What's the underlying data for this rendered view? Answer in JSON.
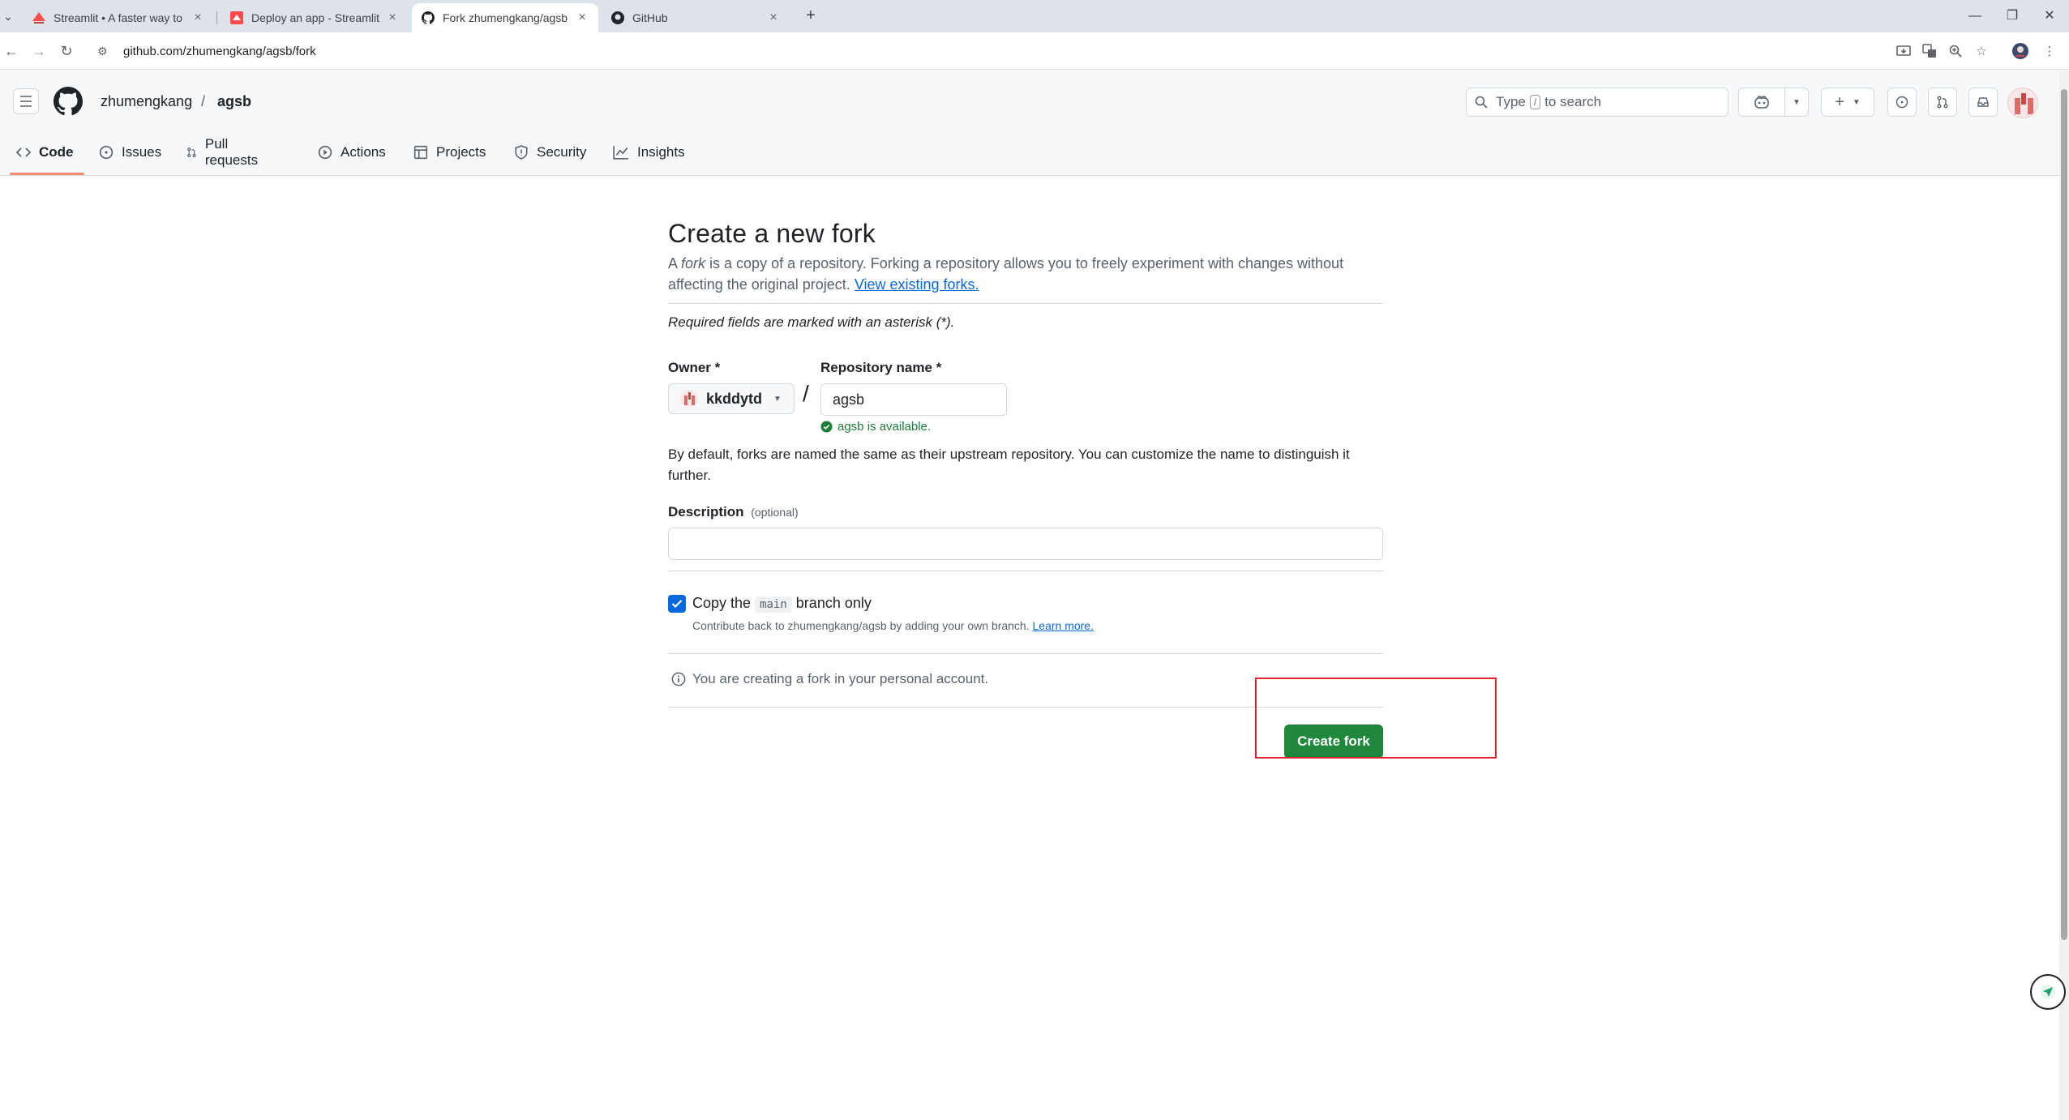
{
  "browser": {
    "tabs": [
      {
        "title": "Streamlit • A faster way to bu",
        "icon": "streamlit-icon"
      },
      {
        "title": "Deploy an app - Streamlit",
        "icon": "streamlit-icon"
      },
      {
        "title": "Fork zhumengkang/agsb",
        "icon": "github-icon",
        "active": true
      },
      {
        "title": "GitHub",
        "icon": "github-icon"
      }
    ],
    "url": "github.com/zhumengkang/agsb/fork"
  },
  "header": {
    "owner": "zhumengkang",
    "separator": "/",
    "repo": "agsb",
    "search": {
      "prefix": "Type",
      "key": "/",
      "suffix": "to search"
    }
  },
  "repo_nav": [
    {
      "label": "Code",
      "icon": "code-icon",
      "active": true
    },
    {
      "label": "Issues",
      "icon": "issue-icon"
    },
    {
      "label": "Pull requests",
      "icon": "pull-request-icon"
    },
    {
      "label": "Actions",
      "icon": "play-icon"
    },
    {
      "label": "Projects",
      "icon": "table-icon"
    },
    {
      "label": "Security",
      "icon": "shield-icon"
    },
    {
      "label": "Insights",
      "icon": "graph-icon"
    }
  ],
  "form": {
    "title": "Create a new fork",
    "lead_a": "A ",
    "lead_fork": "fork",
    "lead_b": " is a copy of a repository. Forking a repository allows you to freely experiment with changes without affecting the original project. ",
    "lead_link": "View existing forks.",
    "required_note": "Required fields are marked with an asterisk (*).",
    "owner_label": "Owner *",
    "owner_value": "kkddytd",
    "slash": "/",
    "repo_label": "Repository name *",
    "repo_value": "agsb",
    "available": "agsb is available.",
    "hint": "By default, forks are named the same as their upstream repository. You can customize the name to distinguish it further.",
    "description_label": "Description",
    "description_optional": "(optional)",
    "copy_prefix": "Copy the",
    "copy_branch": "main",
    "copy_suffix": "branch only",
    "copy_sub": "Contribute back to zhumengkang/agsb by adding your own branch.",
    "learn_more": "Learn more.",
    "info": "You are creating a fork in your personal account.",
    "create_button": "Create fork"
  },
  "colors": {
    "primary_button": "#1f883d",
    "link": "#0969da",
    "success": "#1a7f37",
    "highlight": "#e3202f"
  }
}
